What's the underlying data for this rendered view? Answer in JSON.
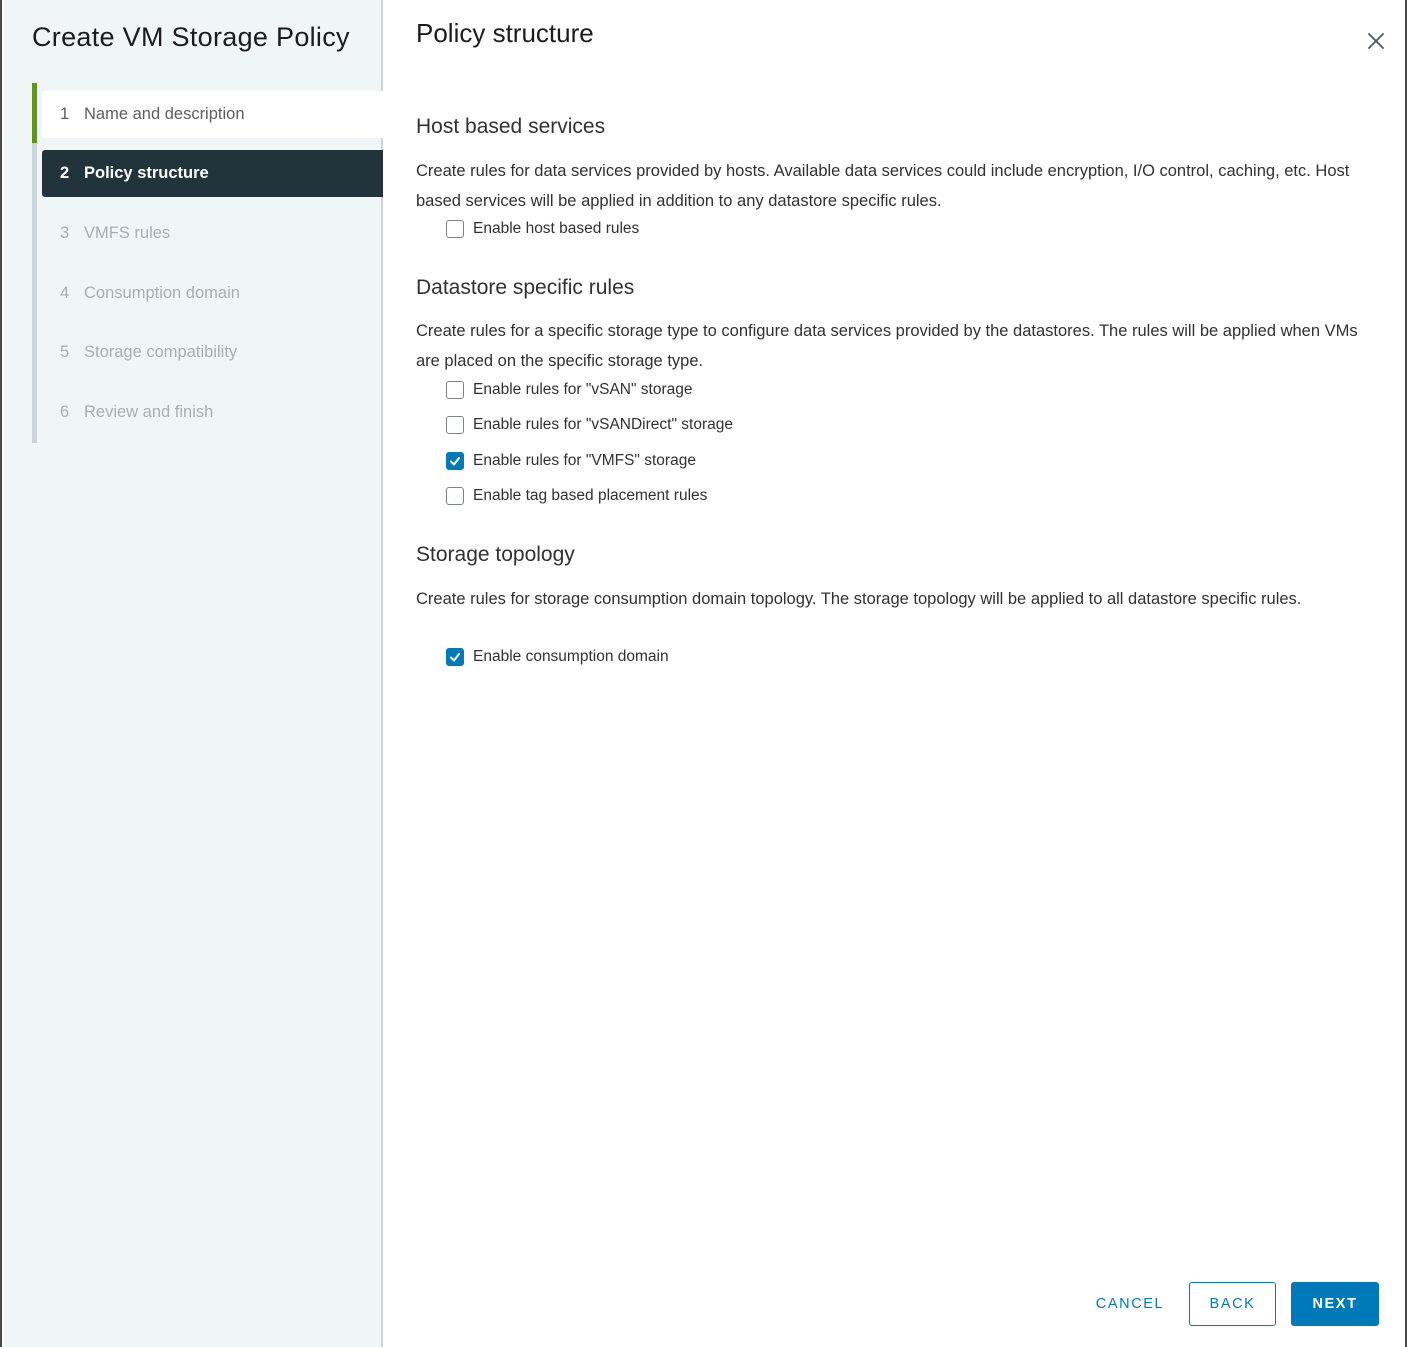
{
  "wizard": {
    "title": "Create VM Storage Policy",
    "steps": [
      {
        "number": "1",
        "label": "Name and description",
        "state": "done"
      },
      {
        "number": "2",
        "label": "Policy structure",
        "state": "active"
      },
      {
        "number": "3",
        "label": "VMFS rules",
        "state": "pending"
      },
      {
        "number": "4",
        "label": "Consumption domain",
        "state": "pending"
      },
      {
        "number": "5",
        "label": "Storage compatibility",
        "state": "pending"
      },
      {
        "number": "6",
        "label": "Review and finish",
        "state": "pending"
      }
    ]
  },
  "main": {
    "title": "Policy structure",
    "close_icon": "close-icon",
    "sections": {
      "host": {
        "title": "Host based services",
        "description": "Create rules for data services provided by hosts. Available data services could include encryption, I/O control, caching, etc. Host based services will be applied in addition to any datastore specific rules.",
        "options": [
          {
            "label": "Enable host based rules",
            "checked": false
          }
        ]
      },
      "datastore": {
        "title": "Datastore specific rules",
        "description": "Create rules for a specific storage type to configure data services provided by the datastores. The rules will be applied when VMs are placed on the specific storage type.",
        "options": [
          {
            "label": "Enable rules for \"vSAN\" storage",
            "checked": false
          },
          {
            "label": "Enable rules for \"vSANDirect\" storage",
            "checked": false
          },
          {
            "label": "Enable rules for \"VMFS\" storage",
            "checked": true
          },
          {
            "label": "Enable tag based placement rules",
            "checked": false
          }
        ]
      },
      "topology": {
        "title": "Storage topology",
        "description": "Create rules for storage consumption domain topology. The storage topology will be applied to all datastore specific rules.",
        "options": [
          {
            "label": "Enable consumption domain",
            "checked": true
          }
        ]
      }
    }
  },
  "footer": {
    "cancel_label": "CANCEL",
    "back_label": "BACK",
    "next_label": "NEXT"
  },
  "colors": {
    "accent": "#0079b8",
    "active_step_bg": "#21333b",
    "done_step_bar": "#5f9420",
    "sidebar_bg": "#f0f5f8"
  }
}
